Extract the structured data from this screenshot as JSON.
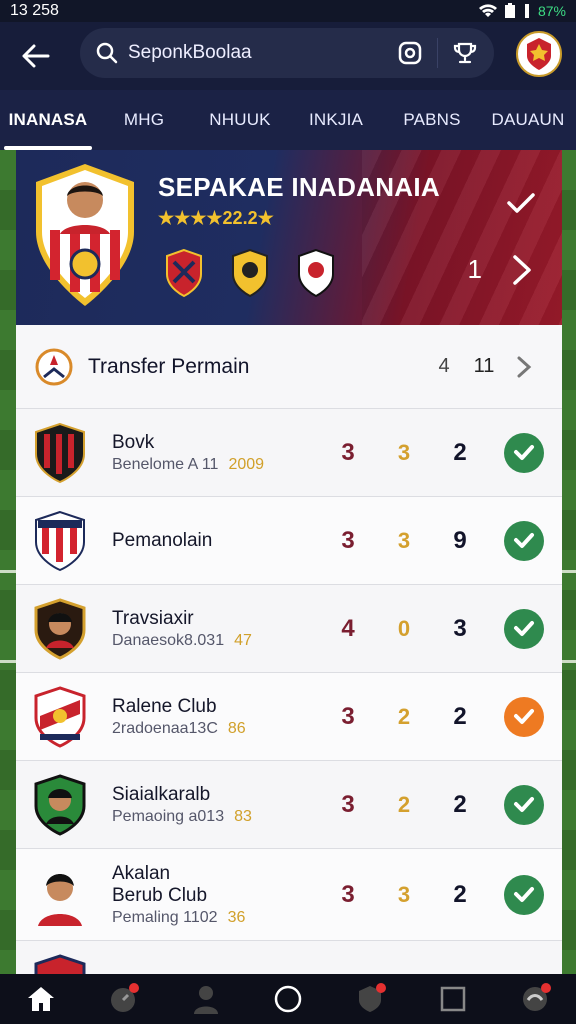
{
  "status": {
    "time": "13 258",
    "battery": "87%"
  },
  "search": {
    "value": "SeponkBoolaa"
  },
  "tabs": [
    {
      "label": "INANASA"
    },
    {
      "label": "MHG"
    },
    {
      "label": "NHUUK"
    },
    {
      "label": "INKJIA"
    },
    {
      "label": "PABNS"
    },
    {
      "label": "DAUAUN"
    }
  ],
  "hero": {
    "title": "SEPAKAE INADANAIA",
    "rating": "★★★★22.2★",
    "count": "1"
  },
  "card": {
    "title": "Transfer Permain",
    "count_a": "4",
    "count_b": "11"
  },
  "rows": [
    {
      "name": "Bovk",
      "sub": "Benelome A 11",
      "year": "2009",
      "v1": "3",
      "v2": "3",
      "v3": "2",
      "status": "ok"
    },
    {
      "name": "Pemanolain",
      "sub": "",
      "year": "",
      "v1": "3",
      "v2": "3",
      "v3": "9",
      "status": "ok"
    },
    {
      "name": "Travsiaxir",
      "sub": "Danaesok8.031",
      "year": "47",
      "v1": "4",
      "v2": "0",
      "v3": "3",
      "status": "ok"
    },
    {
      "name": "Ralene Club",
      "sub": "2radoenaa13C",
      "year": "86",
      "v1": "3",
      "v2": "2",
      "v3": "2",
      "status": "warn"
    },
    {
      "name": "Siaialkaralb",
      "sub": "Pemaoing a013",
      "year": "83",
      "v1": "3",
      "v2": "2",
      "v3": "2",
      "status": "ok"
    },
    {
      "name": "Akalan Berub Club",
      "sub": "Pemaling 1102",
      "year": "36",
      "v1": "3",
      "v2": "3",
      "v3": "2",
      "status": "ok"
    }
  ],
  "colors": {
    "ok": "#2f8a4e",
    "warn": "#ee7a22",
    "accent": "#f2c12e"
  }
}
